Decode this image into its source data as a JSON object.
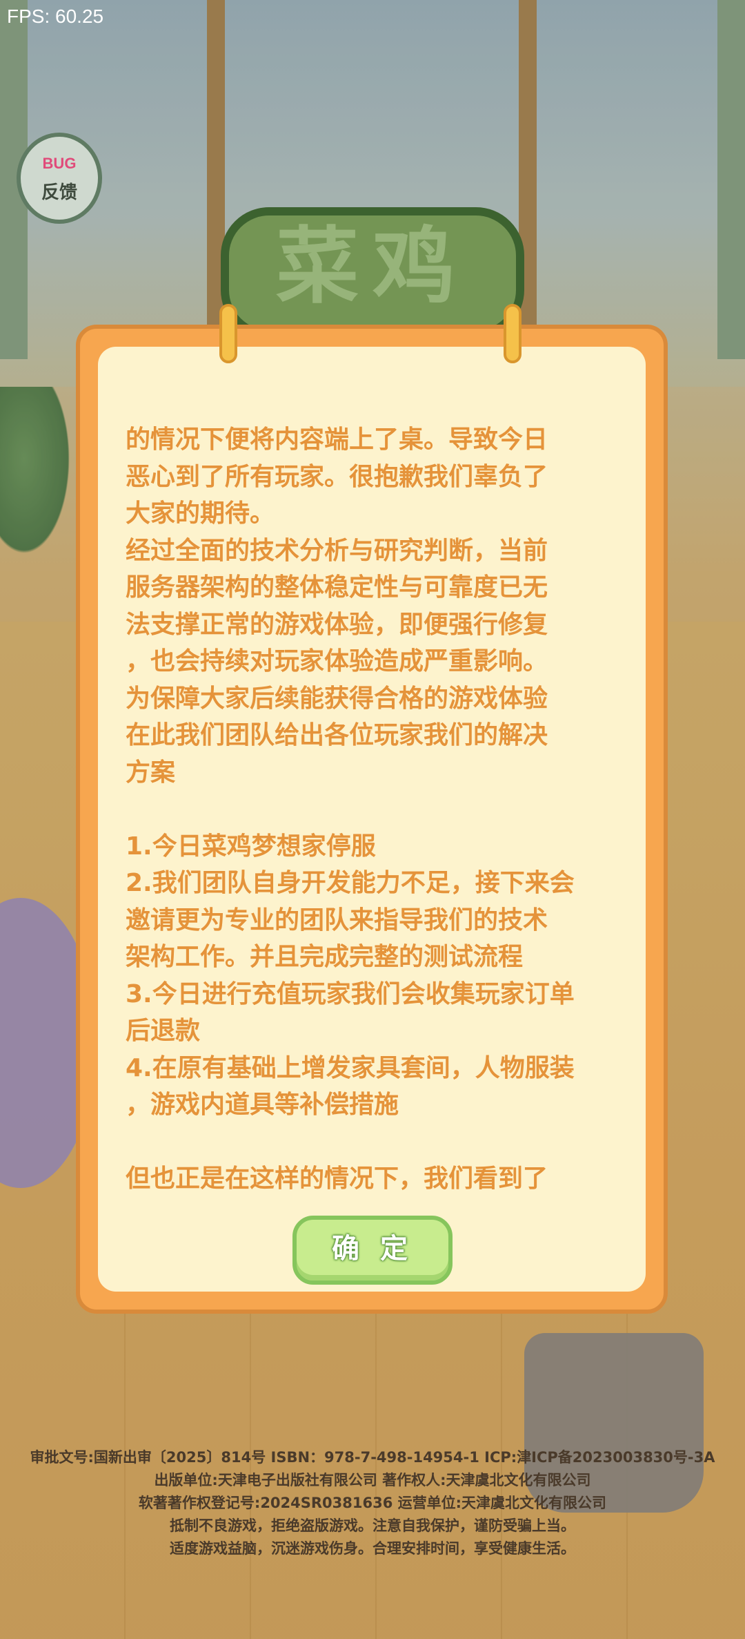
{
  "fps_label": "FPS: 60.25",
  "bug_button": {
    "top_label": "BUG",
    "bottom_label": "反馈"
  },
  "logo_text": "菜鸡",
  "dialog": {
    "lines": [
      "的情况下便将内容端上了桌。导致今日",
      "恶心到了所有玩家。很抱歉我们辜负了",
      "大家的期待。",
      "经过全面的技术分析与研究判断，当前",
      "服务器架构的整体稳定性与可靠度已无",
      "法支撑正常的游戏体验，即便强行修复",
      "，也会持续对玩家体验造成严重影响。",
      "为保障大家后续能获得合格的游戏体验",
      "在此我们团队给出各位玩家我们的解决",
      "方案",
      "",
      "1.今日菜鸡梦想家停服",
      "2.我们团队自身开发能力不足，接下来会",
      "邀请更为专业的团队来指导我们的技术",
      "架构工作。并且完成完整的测试流程",
      "3.今日进行充值玩家我们会收集玩家订单",
      "后退款",
      "4.在原有基础上增发家具套间，人物服装",
      "，游戏内道具等补偿措施",
      "",
      "但也正是在这样的情况下，我们看到了"
    ],
    "confirm_label": "确 定"
  },
  "footer": {
    "line1": "审批文号:国新出审〔2025〕814号   ISBN：978-7-498-14954-1  ICP:津ICP备2023003830号-3A",
    "line2": "出版单位:天津电子出版社有限公司   著作权人:天津虞北文化有限公司",
    "line3": "软著著作权登记号:2024SR0381636   运营单位:天津虞北文化有限公司",
    "line4": "抵制不良游戏，拒绝盗版游戏。注意自我保护，谨防受骗上当。",
    "line5": "适度游戏益脑，沉迷游戏伤身。合理安排时间，享受健康生活。"
  },
  "colors": {
    "dialog_border": "#f7a64f",
    "dialog_bg": "#fdf3cd",
    "text": "#e5933a",
    "confirm_bg": "#c8ec8e"
  }
}
